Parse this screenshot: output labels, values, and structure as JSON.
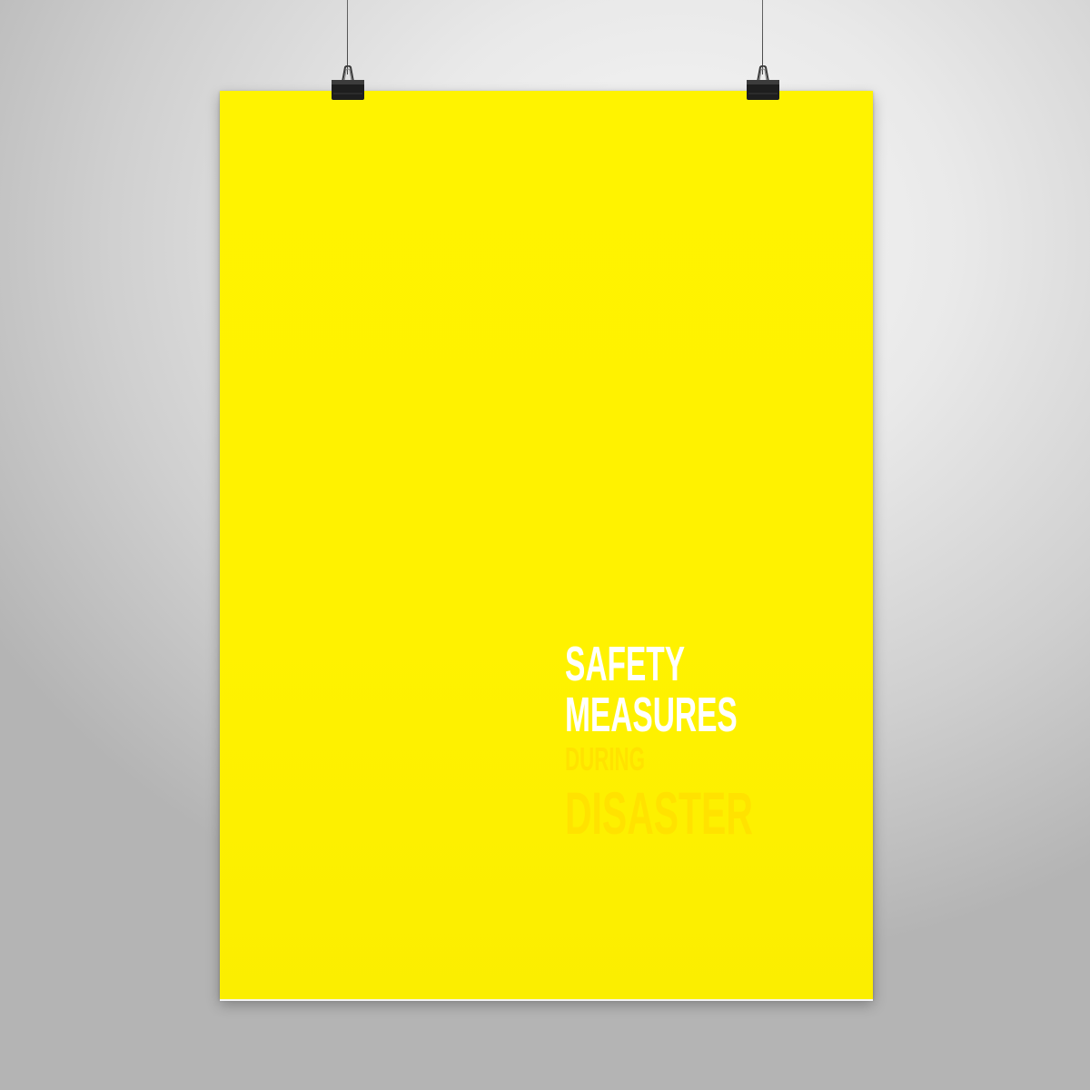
{
  "poster": {
    "background_color": "#fff300",
    "headline": {
      "line1": "SAFETY",
      "line2": "MEASURES",
      "line3": "DURING",
      "line4": "DISASTER"
    },
    "colors": {
      "primary_text": "#ffffff",
      "secondary_text": "#ffe200"
    }
  },
  "wall": {
    "color": "#e9e9e9"
  },
  "clips": [
    {
      "icon": "binder-clip-icon"
    },
    {
      "icon": "binder-clip-icon"
    }
  ]
}
